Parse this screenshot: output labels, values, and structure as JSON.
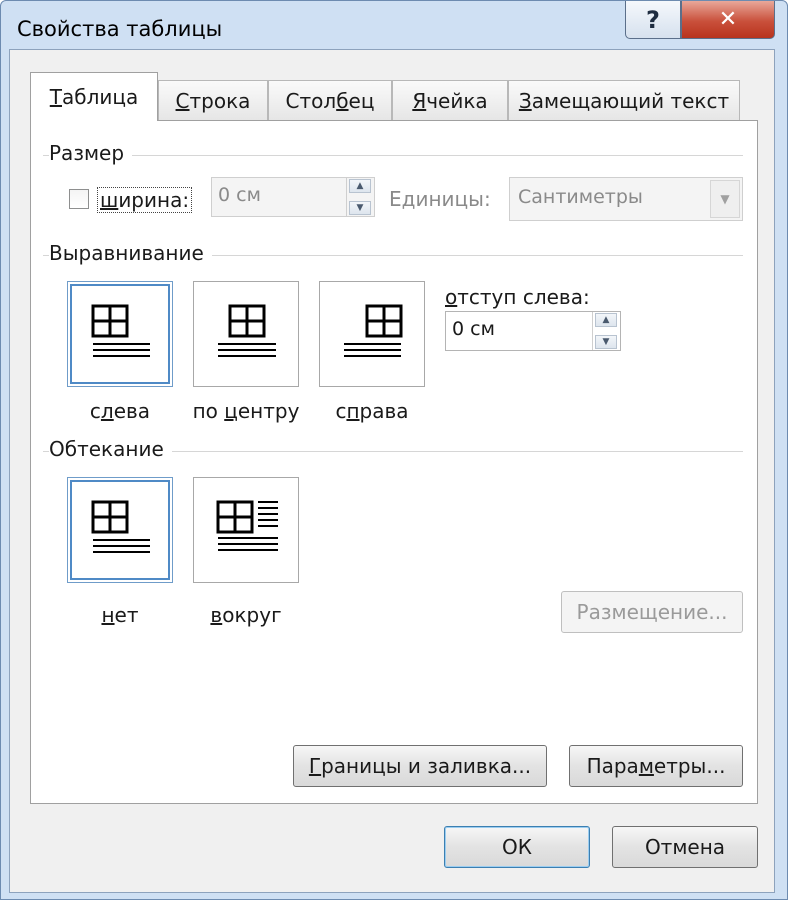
{
  "window": {
    "title": "Свойства таблицы",
    "help_label": "?",
    "close_label": "✕"
  },
  "tabs": [
    {
      "label": "Таблица",
      "accel_pre": "",
      "accel": "Т",
      "accel_post": "аблица"
    },
    {
      "label": "Строка",
      "accel_pre": "",
      "accel": "С",
      "accel_post": "трока"
    },
    {
      "label": "Столбец",
      "accel_pre": "Стол",
      "accel": "б",
      "accel_post": "ец"
    },
    {
      "label": "Ячейка",
      "accel_pre": "",
      "accel": "Я",
      "accel_post": "чейка"
    },
    {
      "label": "Замещающий текст",
      "accel_pre": "",
      "accel": "З",
      "accel_post": "амещающий текст"
    }
  ],
  "size": {
    "group_label": "Размер",
    "width_checkbox_label_accel": "ш",
    "width_checkbox_label_rest": "ирина:",
    "width_value": "0 см",
    "units_label": "Единицы:",
    "units_value": "Сантиметры"
  },
  "alignment": {
    "group_label": "Выравнивание",
    "indent_label_pre": "",
    "indent_label_accel": "о",
    "indent_label_post": "тступ слева:",
    "indent_value": "0 см",
    "options": [
      {
        "pre": "с",
        "accel": "л",
        "post": "ева"
      },
      {
        "pre": "по ",
        "accel": "ц",
        "post": "ентру"
      },
      {
        "pre": "с",
        "accel": "п",
        "post": "рава"
      }
    ]
  },
  "wrapping": {
    "group_label": "Обтекание",
    "options": [
      {
        "pre": "",
        "accel": "н",
        "post": "ет"
      },
      {
        "pre": "",
        "accel": "в",
        "post": "округ"
      }
    ],
    "positioning_button": "Размещение..."
  },
  "panel_buttons": {
    "borders_accel": "Г",
    "borders_rest": "раницы и заливка...",
    "params_pre": "Пара",
    "params_accel": "м",
    "params_post": "етры..."
  },
  "dialog_buttons": {
    "ok": "ОК",
    "cancel": "Отмена"
  },
  "colors": {
    "selection_border": "#4f8ac6",
    "close_button": "#c9503b"
  }
}
